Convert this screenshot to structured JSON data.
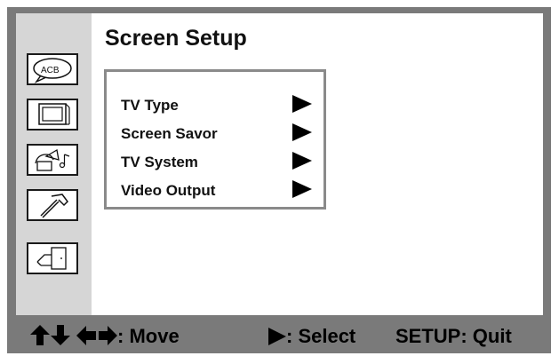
{
  "screen": {
    "title": "Screen Setup"
  },
  "sidebar": {
    "icons": [
      {
        "name": "language-icon",
        "text": "ACB"
      },
      {
        "name": "tv-screen-icon"
      },
      {
        "name": "audio-icon"
      },
      {
        "name": "tools-icon"
      },
      {
        "name": "exit-icon"
      }
    ]
  },
  "menu": {
    "items": [
      {
        "label": "TV Type"
      },
      {
        "label": "Screen Savor"
      },
      {
        "label": "TV System"
      },
      {
        "label": "Video Output"
      }
    ]
  },
  "footer": {
    "move_label": ": Move",
    "select_label": ": Select",
    "quit_label": "SETUP: Quit"
  },
  "colors": {
    "frame": "#7a7a7a",
    "sidebar": "#d6d6d6",
    "menu_border": "#8a8a8a"
  }
}
